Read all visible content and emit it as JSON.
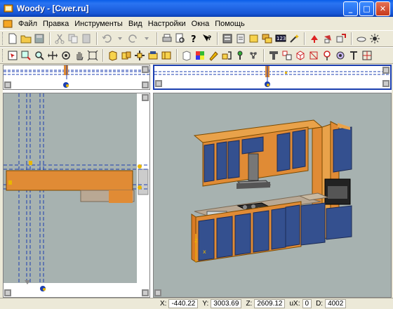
{
  "window": {
    "title": "Woody - [Cwer.ru]",
    "minimize": "_",
    "maximize": "□",
    "close": "✕"
  },
  "menu": [
    {
      "label": "Файл"
    },
    {
      "label": "Правка"
    },
    {
      "label": "Инструменты"
    },
    {
      "label": "Вид"
    },
    {
      "label": "Настройки"
    },
    {
      "label": "Окна"
    },
    {
      "label": "Помощь"
    }
  ],
  "toolbar1": [
    "new-icon",
    "open-icon",
    "save-icon",
    "cut-icon",
    "copy-icon",
    "paste-icon",
    "undo-icon",
    "down-icon",
    "redo-icon",
    "down-icon",
    "print-icon",
    "preview-icon",
    "help-icon",
    "context-help-icon",
    "library-icon",
    "parts-icon",
    "components-icon",
    "layers-icon",
    "counter-icon",
    "magic-icon",
    "red-arrow-icon",
    "rotate-icon",
    "swap-icon",
    "cloud-icon",
    "light-icon"
  ],
  "toolbar2": [
    "select-icon",
    "zoom-region-icon",
    "zoom-icon",
    "pan-icon",
    "orbit-icon",
    "hand-icon",
    "fit-icon",
    "box-icon",
    "cabinet-icon",
    "move-icon",
    "drawer-icon",
    "panel-icon",
    "edit-icon",
    "color-icon",
    "material-icon",
    "shelf-icon",
    "handle-icon",
    "link-icon",
    "plane-icon",
    "group-icon",
    "cube-icon",
    "wire-icon",
    "sphere-icon",
    "camera-icon",
    "text-icon",
    "split-icon"
  ],
  "status": {
    "x_label": "X:",
    "x": "-440.22",
    "y_label": "Y:",
    "y": "3003.69",
    "z_label": "Z:",
    "z": "2609.12",
    "ux_label": "uX:",
    "ux": "0",
    "d_label": "D:",
    "d": "4002"
  },
  "colors": {
    "title_bar": "#1757d6",
    "viewport_bg": "#a7b2b0",
    "wood": "#e08b35",
    "door_blue": "#34508f"
  }
}
